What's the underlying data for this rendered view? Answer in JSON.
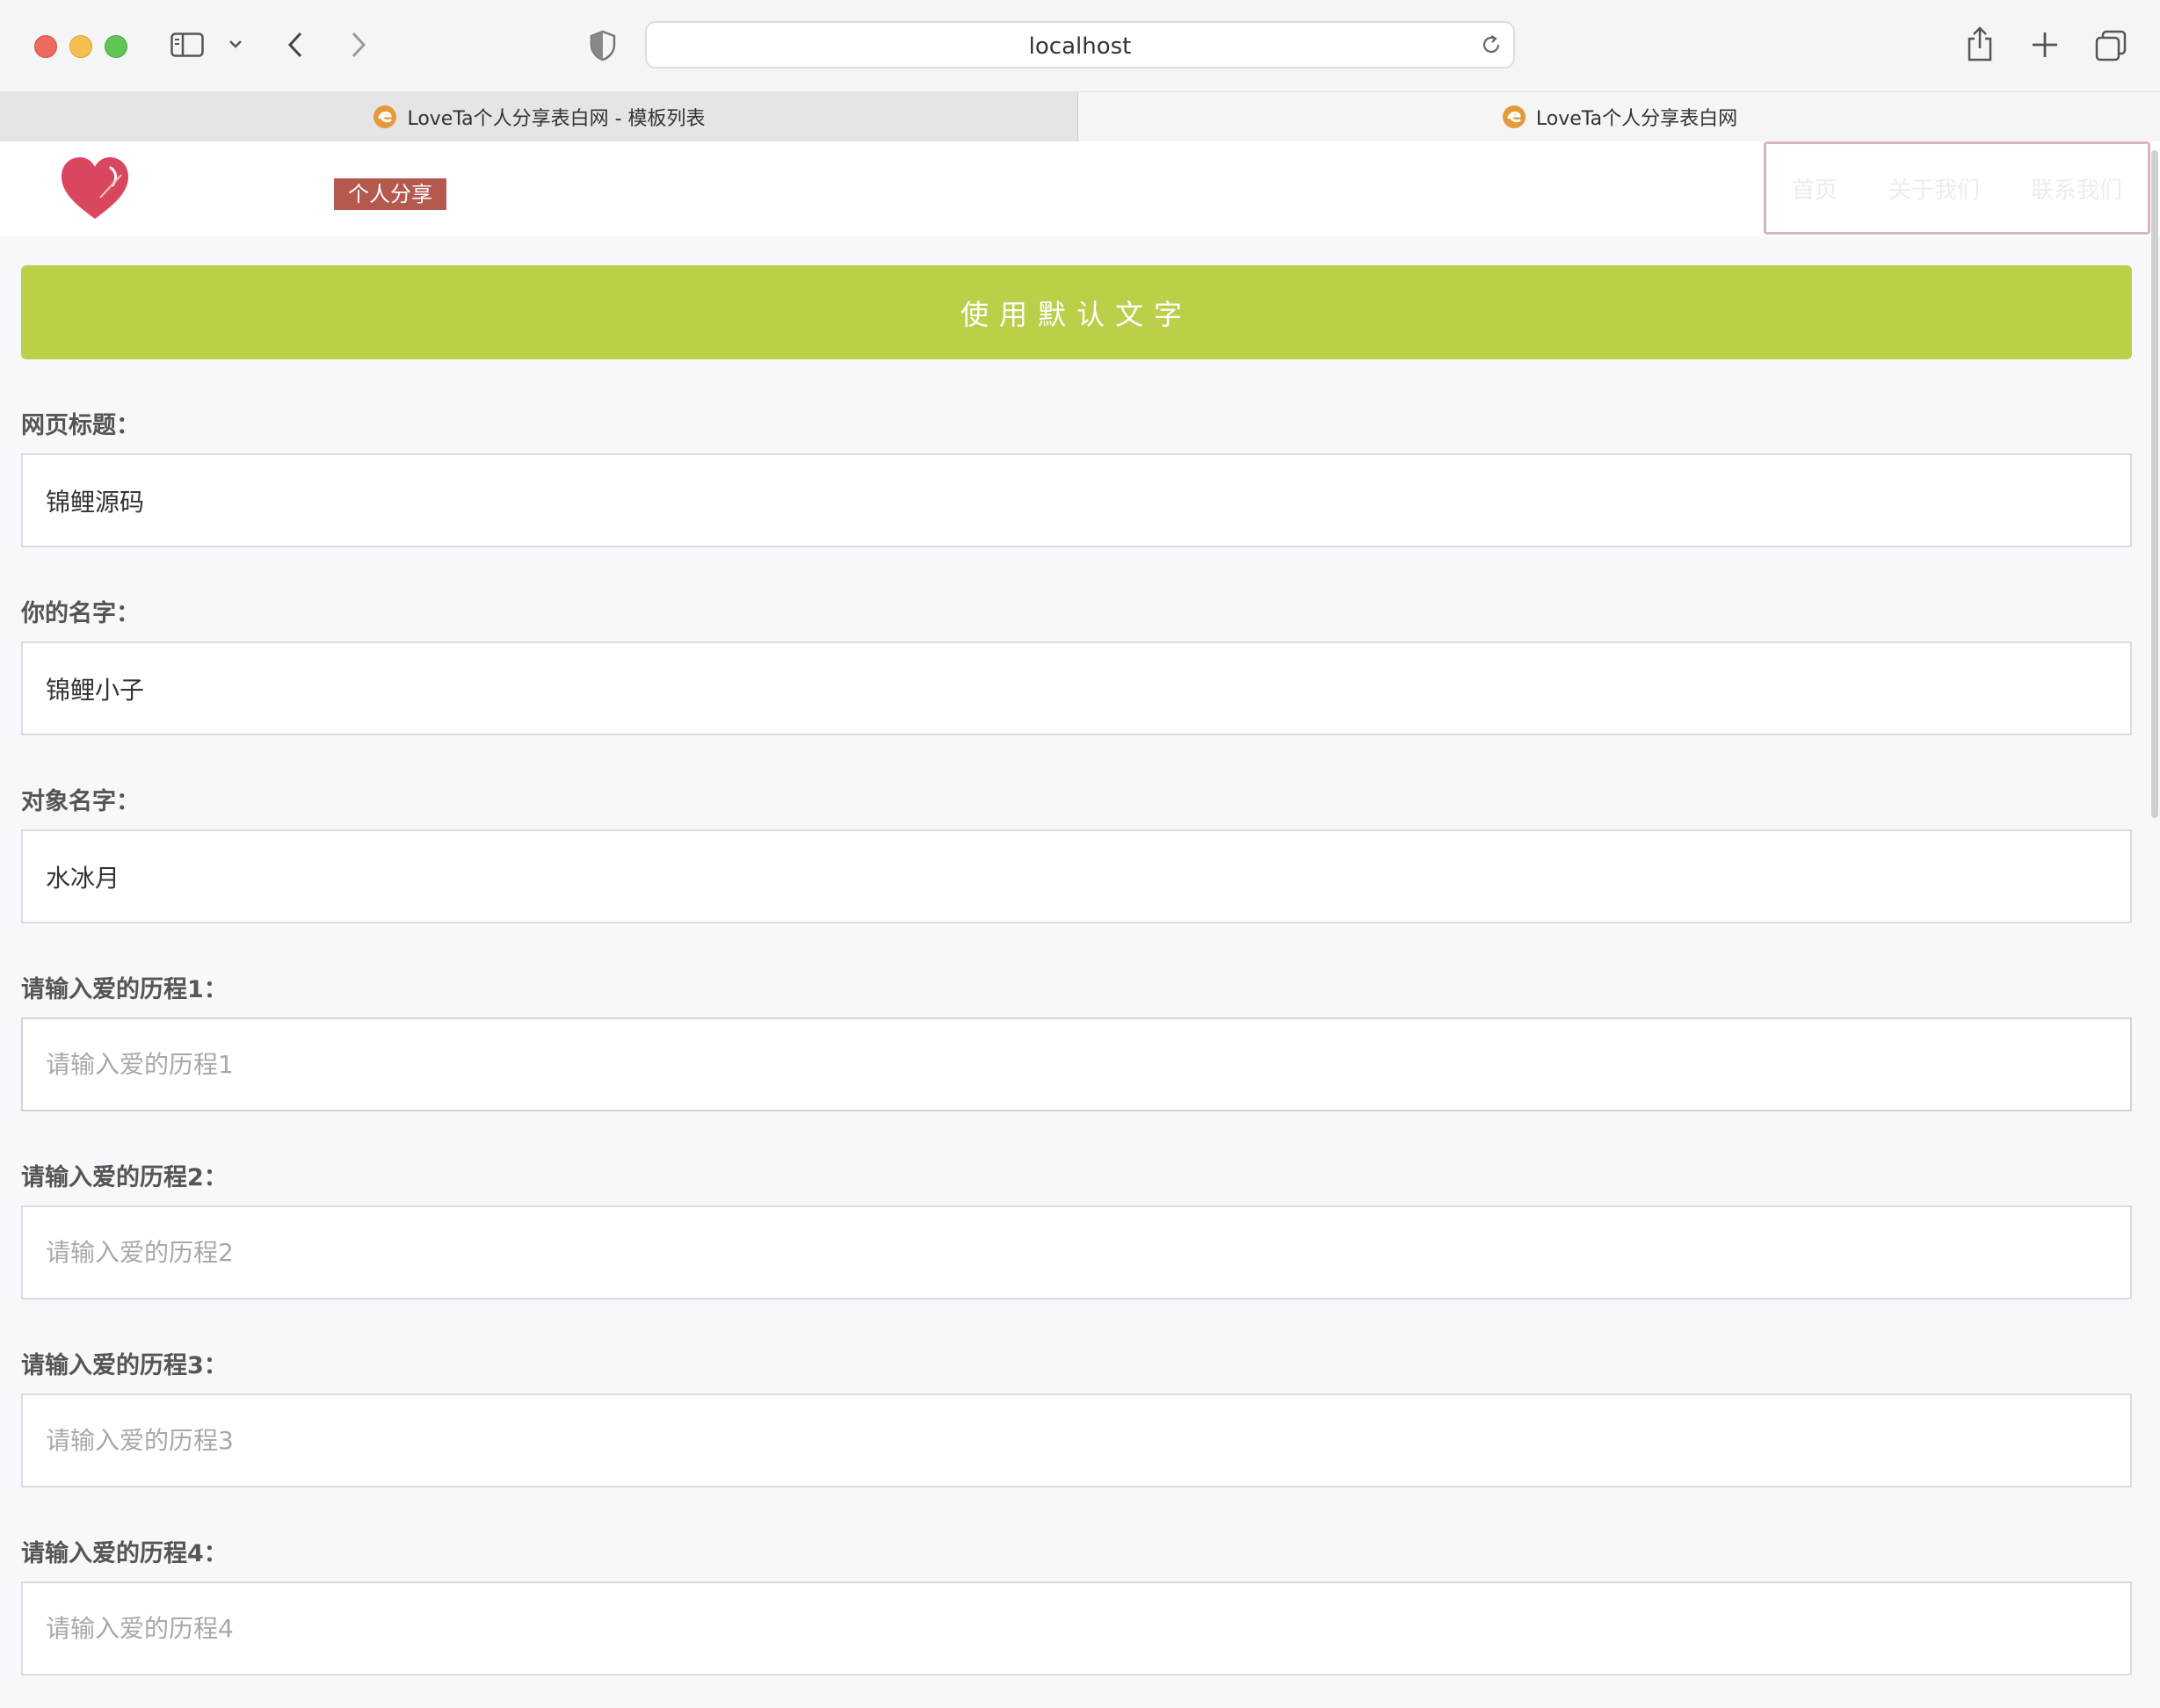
{
  "browser": {
    "url": "localhost",
    "tabs": [
      {
        "title": "LoveTa个人分享表白网 - 模板列表",
        "active": false
      },
      {
        "title": "LoveTa个人分享表白网",
        "active": true
      }
    ]
  },
  "site": {
    "badge": "个人分享",
    "nav": [
      "首页",
      "关于我们",
      "联系我们"
    ]
  },
  "form": {
    "default_button": "使用默认文字",
    "fields": [
      {
        "label": "网页标题：",
        "value": "锦鲤源码",
        "placeholder": ""
      },
      {
        "label": "你的名字：",
        "value": "锦鲤小子",
        "placeholder": ""
      },
      {
        "label": "对象名字：",
        "value": "水冰月",
        "placeholder": ""
      },
      {
        "label": "请输入爱的历程1：",
        "value": "",
        "placeholder": "请输入爱的历程1"
      },
      {
        "label": "请输入爱的历程2：",
        "value": "",
        "placeholder": "请输入爱的历程2"
      },
      {
        "label": "请输入爱的历程3：",
        "value": "",
        "placeholder": "请输入爱的历程3"
      },
      {
        "label": "请输入爱的历程4：",
        "value": "",
        "placeholder": "请输入爱的历程4"
      }
    ]
  },
  "colors": {
    "accent_button": "#bbcf49",
    "badge": "#b5584d",
    "heart": "#d9475f"
  }
}
